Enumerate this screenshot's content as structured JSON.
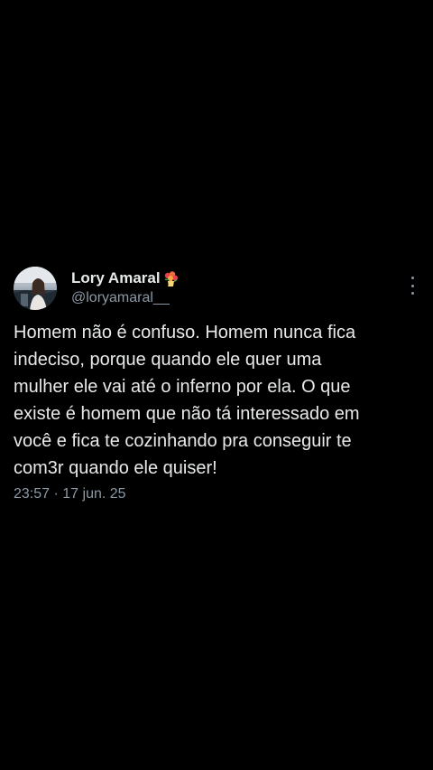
{
  "tweet": {
    "author": {
      "display_name": "Lory Amaral",
      "handle": "@loryamaral__",
      "name_emoji": "bouquet-icon",
      "avatar": "avatar"
    },
    "more_icon": "more-vertical-icon",
    "lines": [
      "Homem não é confuso. Homem nunca fica",
      "indeciso, porque quando ele quer uma",
      "mulher ele vai até o inferno por ela. O que",
      "existe é homem que não tá interessado em",
      "você e fica te cozinhando pra conseguir te",
      "com3r quando ele quiser!"
    ],
    "time": "23:57",
    "separator": "·",
    "date": "17 jun. 25"
  },
  "colors": {
    "background": "#000000",
    "text": "#e7e9ea",
    "secondary": "#8b98a5"
  }
}
